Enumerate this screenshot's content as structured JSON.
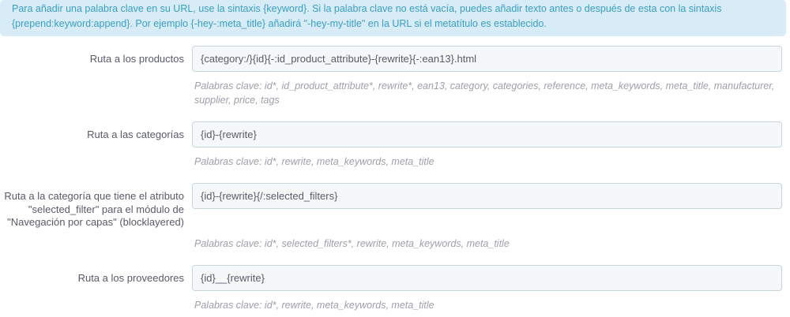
{
  "alert": {
    "text": "Para añadir una palabra clave en su URL, use la sintaxis {keyword}. Si la palabra clave no está vacía, puedes añadir texto antes o después de esta con la sintaxis {prepend:keyword:append}. Por ejemplo {-hey-:meta_title} añadirá \"-hey-my-title\" en la URL si el metatítulo es establecido."
  },
  "colors": {
    "alert_bg": "#d7ecf6",
    "alert_text": "#3a9ec4",
    "input_bg": "#f5f8f9",
    "input_border": "#c7d6db",
    "label_text": "#585a69",
    "help_text": "#9f9fa8"
  },
  "form": {
    "rows": [
      {
        "label": "Ruta a los productos",
        "value": "{category:/}{id}{-:id_product_attribute}-{rewrite}{-:ean13}.html",
        "help": "Palabras clave: id*, id_product_attribute*, rewrite*, ean13, category, categories, reference, meta_keywords, meta_title, manufacturer, supplier, price, tags"
      },
      {
        "label": "Ruta a las categorías",
        "value": "{id}-{rewrite}",
        "help": "Palabras clave: id*, rewrite, meta_keywords, meta_title"
      },
      {
        "label": "Ruta a la categoría que tiene el atributo \"selected_filter\" para el módulo de \"Navegación por capas\" (blocklayered)",
        "value": "{id}-{rewrite}{/:selected_filters}",
        "help": "Palabras clave: id*, selected_filters*, rewrite, meta_keywords, meta_title"
      },
      {
        "label": "Ruta a los proveedores",
        "value": "{id}__{rewrite}",
        "help": "Palabras clave: id*, rewrite, meta_keywords, meta_title"
      }
    ]
  }
}
